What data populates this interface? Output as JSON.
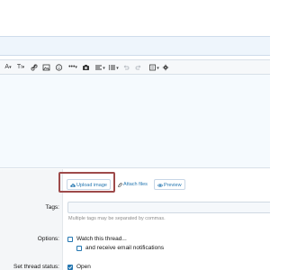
{
  "editor_toolbar": {
    "font_size": "A",
    "text_style": "T",
    "items": [
      "font-size",
      "text-style",
      "link",
      "image",
      "emoji",
      "more",
      "camera",
      "align",
      "list",
      "undo",
      "redo",
      "preview",
      "settings"
    ]
  },
  "attachments": {
    "upload_image_label": "Upload image",
    "attach_files_label": "Attach files",
    "preview_label": "Preview"
  },
  "tags": {
    "label": "Tags:",
    "hint": "Multiple tags may be separated by commas."
  },
  "options": {
    "label": "Options:",
    "watch_thread_label": "Watch this thread...",
    "email_notifications_label": "and receive email notifications"
  },
  "thread_status": {
    "label": "Set thread status:",
    "open_label": "Open"
  },
  "colors": {
    "accent": "#2577b1",
    "highlight_border": "#9e4a4a"
  }
}
